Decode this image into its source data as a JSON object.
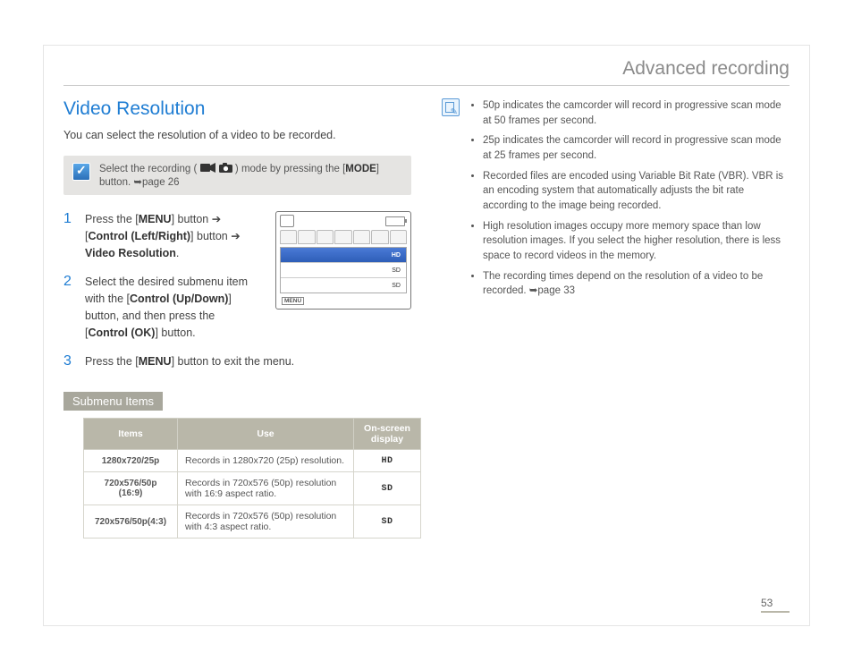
{
  "header": {
    "title": "Advanced recording"
  },
  "section": {
    "title": "Video Resolution",
    "intro": "You can select the resolution of a video to be recorded."
  },
  "modebox": {
    "prefix": "Select the recording ( ",
    "suffix": " ) mode by pressing the [",
    "mode": "MODE",
    "after": "] button. ",
    "pageref": "➥page 26"
  },
  "steps": {
    "s1a": "Press the [",
    "s1menu": "MENU",
    "s1b": "] button ➔ [",
    "s1ctrl": "Control (Left/Right)",
    "s1c": "] button ➔ ",
    "s1vr": "Video Resolution",
    "s1d": ".",
    "s2a": "Select the desired submenu item with the [",
    "s2ctrl": "Control (Up/Down)",
    "s2b": "] button, and then press the [",
    "s2ok": "Control (OK)",
    "s2c": "] button.",
    "s3a": "Press the [",
    "s3menu": "MENU",
    "s3b": "] button to exit the menu."
  },
  "lcd": {
    "row1": "HD",
    "row2": "SD",
    "row3": "SD",
    "menu": "MENU"
  },
  "submenu": {
    "title": "Submenu Items",
    "headers": {
      "items": "Items",
      "use": "Use",
      "osd": "On-screen display"
    },
    "rows": [
      {
        "item": "1280x720/25p",
        "use": "Records in 1280x720 (25p) resolution.",
        "osd": "HD"
      },
      {
        "item": "720x576/50p (16:9)",
        "use": "Records in 720x576 (50p) resolution with 16:9 aspect ratio.",
        "osd": "SD"
      },
      {
        "item": "720x576/50p(4:3)",
        "use": "Records in 720x576 (50p) resolution with 4:3 aspect ratio.",
        "osd": "SD"
      }
    ]
  },
  "notes": [
    "50p indicates the camcorder will record in progressive scan mode at 50 frames per second.",
    "25p indicates the camcorder will record in progressive scan mode at 25 frames per second.",
    "Recorded files are encoded using Variable Bit Rate (VBR). VBR is an encoding system that automatically adjusts the bit rate according to the image being recorded.",
    "High resolution images occupy more memory space than low resolution images. If you select the higher resolution, there is less space to record videos in the memory.",
    "The recording times depend on the resolution of a video to be recorded. ➥page 33"
  ],
  "pagenum": "53"
}
